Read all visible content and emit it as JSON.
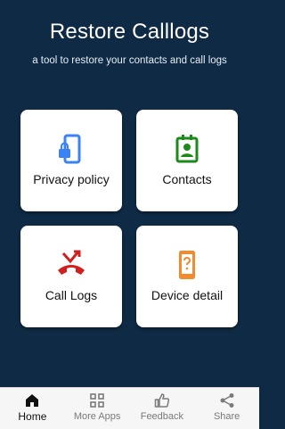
{
  "header": {
    "title": "Restore Calllogs",
    "subtitle": "a tool to restore your contacts and  call logs"
  },
  "tiles": [
    {
      "label": "Privacy policy",
      "icon": "phone-lock-icon",
      "color": "#3b82f6"
    },
    {
      "label": "Contacts",
      "icon": "contact-card-icon",
      "color": "#1a8a1a"
    },
    {
      "label": "Call Logs",
      "icon": "missed-call-icon",
      "color": "#d11f1f"
    },
    {
      "label": "Device detail",
      "icon": "phone-question-icon",
      "color": "#f28a2e"
    }
  ],
  "bottom_nav": {
    "items": [
      {
        "label": "Home",
        "icon": "home-icon",
        "active": true
      },
      {
        "label": "More Apps",
        "icon": "grid-icon",
        "active": false
      },
      {
        "label": "Feedback",
        "icon": "thumbs-up-icon",
        "active": false
      },
      {
        "label": "Share",
        "icon": "share-icon",
        "active": false
      }
    ]
  },
  "colors": {
    "background": "#0f2a44",
    "tile": "#ffffff",
    "nav_background": "#f6f6f6"
  }
}
